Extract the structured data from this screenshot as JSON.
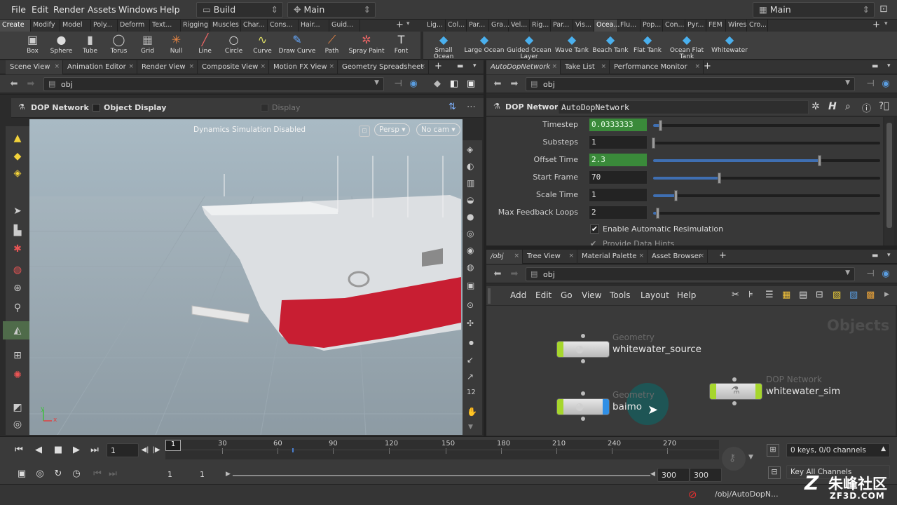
{
  "menubar": {
    "items": [
      "File",
      "Edit",
      "Render",
      "Assets",
      "Windows",
      "Help"
    ],
    "build_label": "Build",
    "desktop_label": "Main",
    "right_desktop_label": "Main"
  },
  "shelf_tabs_left": [
    "Create",
    "Modify",
    "Model",
    "Poly...",
    "Deform",
    "Text...",
    "Rigging",
    "Muscles",
    "Char...",
    "Cons...",
    "Hair...",
    "Guid..."
  ],
  "shelf_tabs_right": [
    "Lig...",
    "Col...",
    "Par...",
    "Gra...",
    "Vel...",
    "Rig...",
    "Par...",
    "Vis...",
    "Ocea...",
    "Flu...",
    "Pop...",
    "Con...",
    "Pyr...",
    "FEM",
    "Wires",
    "Cro..."
  ],
  "shelf_tools_left": [
    "Box",
    "Sphere",
    "Tube",
    "Torus",
    "Grid",
    "Null",
    "Line",
    "Circle",
    "Curve",
    "Draw Curve",
    "Path",
    "Spray Paint",
    "Font"
  ],
  "shelf_tools_right": [
    "Small Ocean",
    "Large Ocean",
    "Guided Ocean Layer",
    "Wave Tank",
    "Beach Tank",
    "Flat Tank",
    "Ocean Flat Tank",
    "Whitewater"
  ],
  "left_panel": {
    "tabs": [
      "Scene View",
      "Animation Editor",
      "Render View",
      "Composite View",
      "Motion FX View",
      "Geometry Spreadsheet"
    ],
    "path": "obj",
    "context": "DOP Network",
    "object_display": "Object Display",
    "display_label": "Display",
    "viewport_message": "Dynamics Simulation Disabled",
    "persp": "Persp",
    "cam": "No cam",
    "axis_y": "y",
    "axis_x": "x"
  },
  "param_panel": {
    "tabs": [
      "AutoDopNetwork",
      "Take List",
      "Performance Monitor"
    ],
    "path": "obj",
    "node_type": "DOP Network",
    "node_name": "AutoDopNetwork",
    "params": [
      {
        "label": "Timestep",
        "value": "0.0333333",
        "highlight": true,
        "slider": 0.03
      },
      {
        "label": "Substeps",
        "value": "1",
        "highlight": false,
        "slider": 0.0
      },
      {
        "label": "Offset Time",
        "value": "2.3",
        "highlight": true,
        "slider": 0.73
      },
      {
        "label": "Start Frame",
        "value": "70",
        "highlight": false,
        "slider": 0.29
      },
      {
        "label": "Scale Time",
        "value": "1",
        "highlight": false,
        "slider": 0.1
      },
      {
        "label": "Max Feedback Loops",
        "value": "2",
        "highlight": false,
        "slider": 0.02
      }
    ],
    "checkbox_label": "Enable Automatic Resimulation",
    "cut_label": "Provide Data Hints"
  },
  "network_panel": {
    "tabs": [
      "/obj",
      "Tree View",
      "Material Palette",
      "Asset Browser"
    ],
    "path": "obj",
    "menu": [
      "Add",
      "Edit",
      "Go",
      "View",
      "Tools",
      "Layout",
      "Help"
    ],
    "watermark": "Objects",
    "nodes": [
      {
        "type": "Geometry",
        "name": "whitewater_source"
      },
      {
        "type": "Geometry",
        "name": "baimo"
      },
      {
        "type": "DOP Network",
        "name": "whitewater_sim"
      }
    ]
  },
  "playbar": {
    "current_frame": "1",
    "ticks": [
      "1",
      "30",
      "60",
      "90",
      "120",
      "150",
      "180",
      "210",
      "240",
      "270"
    ],
    "start": "1",
    "start2": "1",
    "end": "300",
    "end2": "300",
    "keys_label": "0 keys, 0/0 channels",
    "key_all": "Key All Channels",
    "status_path": "/obj/AutoDopN..."
  },
  "brand": {
    "cn": "朱峰社区",
    "site": "ZF3D.COM"
  },
  "colors": {
    "param_green": "#3a8a3a",
    "node_flag_green": "#a6d62c",
    "display_flag_blue": "#2f8fe6",
    "hull_red": "#c81e32"
  }
}
